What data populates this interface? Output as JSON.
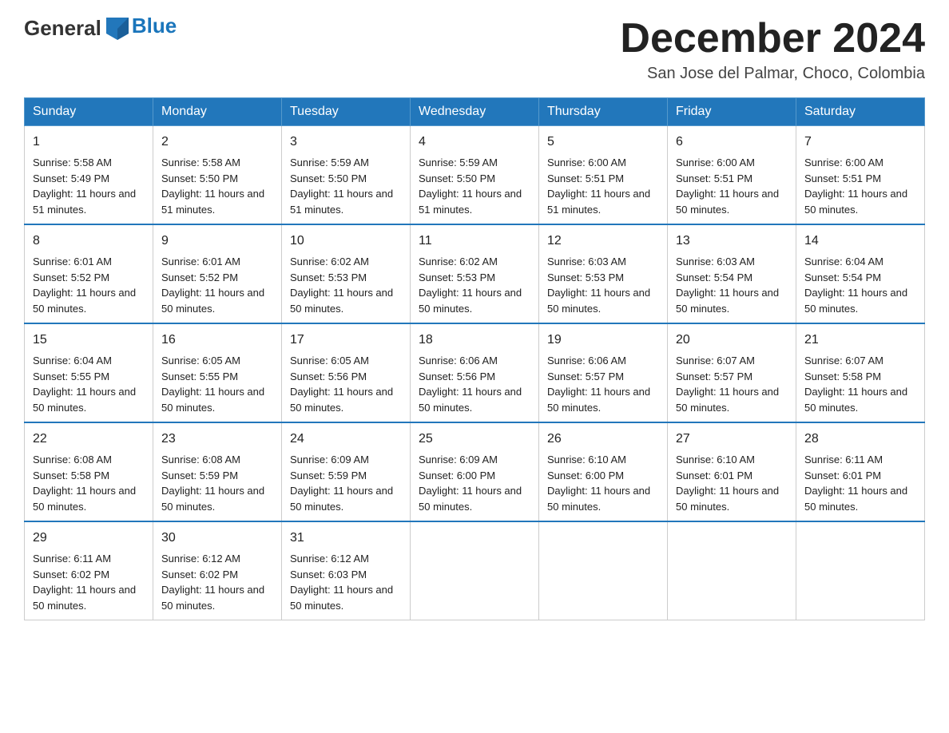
{
  "header": {
    "logo_general": "General",
    "logo_blue": "Blue",
    "title": "December 2024",
    "location": "San Jose del Palmar, Choco, Colombia"
  },
  "weekdays": [
    "Sunday",
    "Monday",
    "Tuesday",
    "Wednesday",
    "Thursday",
    "Friday",
    "Saturday"
  ],
  "weeks": [
    [
      {
        "day": "1",
        "sunrise": "Sunrise: 5:58 AM",
        "sunset": "Sunset: 5:49 PM",
        "daylight": "Daylight: 11 hours and 51 minutes."
      },
      {
        "day": "2",
        "sunrise": "Sunrise: 5:58 AM",
        "sunset": "Sunset: 5:50 PM",
        "daylight": "Daylight: 11 hours and 51 minutes."
      },
      {
        "day": "3",
        "sunrise": "Sunrise: 5:59 AM",
        "sunset": "Sunset: 5:50 PM",
        "daylight": "Daylight: 11 hours and 51 minutes."
      },
      {
        "day": "4",
        "sunrise": "Sunrise: 5:59 AM",
        "sunset": "Sunset: 5:50 PM",
        "daylight": "Daylight: 11 hours and 51 minutes."
      },
      {
        "day": "5",
        "sunrise": "Sunrise: 6:00 AM",
        "sunset": "Sunset: 5:51 PM",
        "daylight": "Daylight: 11 hours and 51 minutes."
      },
      {
        "day": "6",
        "sunrise": "Sunrise: 6:00 AM",
        "sunset": "Sunset: 5:51 PM",
        "daylight": "Daylight: 11 hours and 50 minutes."
      },
      {
        "day": "7",
        "sunrise": "Sunrise: 6:00 AM",
        "sunset": "Sunset: 5:51 PM",
        "daylight": "Daylight: 11 hours and 50 minutes."
      }
    ],
    [
      {
        "day": "8",
        "sunrise": "Sunrise: 6:01 AM",
        "sunset": "Sunset: 5:52 PM",
        "daylight": "Daylight: 11 hours and 50 minutes."
      },
      {
        "day": "9",
        "sunrise": "Sunrise: 6:01 AM",
        "sunset": "Sunset: 5:52 PM",
        "daylight": "Daylight: 11 hours and 50 minutes."
      },
      {
        "day": "10",
        "sunrise": "Sunrise: 6:02 AM",
        "sunset": "Sunset: 5:53 PM",
        "daylight": "Daylight: 11 hours and 50 minutes."
      },
      {
        "day": "11",
        "sunrise": "Sunrise: 6:02 AM",
        "sunset": "Sunset: 5:53 PM",
        "daylight": "Daylight: 11 hours and 50 minutes."
      },
      {
        "day": "12",
        "sunrise": "Sunrise: 6:03 AM",
        "sunset": "Sunset: 5:53 PM",
        "daylight": "Daylight: 11 hours and 50 minutes."
      },
      {
        "day": "13",
        "sunrise": "Sunrise: 6:03 AM",
        "sunset": "Sunset: 5:54 PM",
        "daylight": "Daylight: 11 hours and 50 minutes."
      },
      {
        "day": "14",
        "sunrise": "Sunrise: 6:04 AM",
        "sunset": "Sunset: 5:54 PM",
        "daylight": "Daylight: 11 hours and 50 minutes."
      }
    ],
    [
      {
        "day": "15",
        "sunrise": "Sunrise: 6:04 AM",
        "sunset": "Sunset: 5:55 PM",
        "daylight": "Daylight: 11 hours and 50 minutes."
      },
      {
        "day": "16",
        "sunrise": "Sunrise: 6:05 AM",
        "sunset": "Sunset: 5:55 PM",
        "daylight": "Daylight: 11 hours and 50 minutes."
      },
      {
        "day": "17",
        "sunrise": "Sunrise: 6:05 AM",
        "sunset": "Sunset: 5:56 PM",
        "daylight": "Daylight: 11 hours and 50 minutes."
      },
      {
        "day": "18",
        "sunrise": "Sunrise: 6:06 AM",
        "sunset": "Sunset: 5:56 PM",
        "daylight": "Daylight: 11 hours and 50 minutes."
      },
      {
        "day": "19",
        "sunrise": "Sunrise: 6:06 AM",
        "sunset": "Sunset: 5:57 PM",
        "daylight": "Daylight: 11 hours and 50 minutes."
      },
      {
        "day": "20",
        "sunrise": "Sunrise: 6:07 AM",
        "sunset": "Sunset: 5:57 PM",
        "daylight": "Daylight: 11 hours and 50 minutes."
      },
      {
        "day": "21",
        "sunrise": "Sunrise: 6:07 AM",
        "sunset": "Sunset: 5:58 PM",
        "daylight": "Daylight: 11 hours and 50 minutes."
      }
    ],
    [
      {
        "day": "22",
        "sunrise": "Sunrise: 6:08 AM",
        "sunset": "Sunset: 5:58 PM",
        "daylight": "Daylight: 11 hours and 50 minutes."
      },
      {
        "day": "23",
        "sunrise": "Sunrise: 6:08 AM",
        "sunset": "Sunset: 5:59 PM",
        "daylight": "Daylight: 11 hours and 50 minutes."
      },
      {
        "day": "24",
        "sunrise": "Sunrise: 6:09 AM",
        "sunset": "Sunset: 5:59 PM",
        "daylight": "Daylight: 11 hours and 50 minutes."
      },
      {
        "day": "25",
        "sunrise": "Sunrise: 6:09 AM",
        "sunset": "Sunset: 6:00 PM",
        "daylight": "Daylight: 11 hours and 50 minutes."
      },
      {
        "day": "26",
        "sunrise": "Sunrise: 6:10 AM",
        "sunset": "Sunset: 6:00 PM",
        "daylight": "Daylight: 11 hours and 50 minutes."
      },
      {
        "day": "27",
        "sunrise": "Sunrise: 6:10 AM",
        "sunset": "Sunset: 6:01 PM",
        "daylight": "Daylight: 11 hours and 50 minutes."
      },
      {
        "day": "28",
        "sunrise": "Sunrise: 6:11 AM",
        "sunset": "Sunset: 6:01 PM",
        "daylight": "Daylight: 11 hours and 50 minutes."
      }
    ],
    [
      {
        "day": "29",
        "sunrise": "Sunrise: 6:11 AM",
        "sunset": "Sunset: 6:02 PM",
        "daylight": "Daylight: 11 hours and 50 minutes."
      },
      {
        "day": "30",
        "sunrise": "Sunrise: 6:12 AM",
        "sunset": "Sunset: 6:02 PM",
        "daylight": "Daylight: 11 hours and 50 minutes."
      },
      {
        "day": "31",
        "sunrise": "Sunrise: 6:12 AM",
        "sunset": "Sunset: 6:03 PM",
        "daylight": "Daylight: 11 hours and 50 minutes."
      },
      null,
      null,
      null,
      null
    ]
  ]
}
